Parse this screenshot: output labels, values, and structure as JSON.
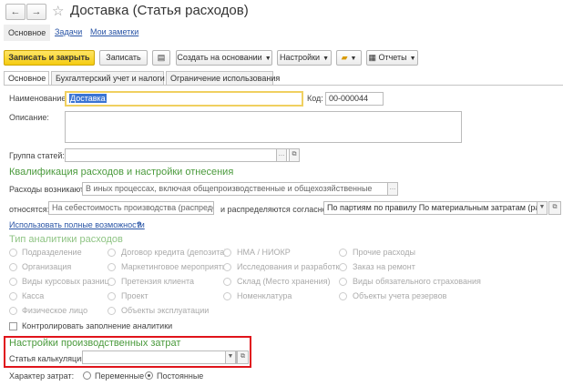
{
  "window": {
    "title": "Доставка (Статья расходов)"
  },
  "nav": {
    "back_glyph": "←",
    "forward_glyph": "→"
  },
  "top_tabs": {
    "main": "Основное",
    "tasks": "Задачи",
    "notes": "Мои заметки"
  },
  "toolbar": {
    "save_close": "Записать и закрыть",
    "save": "Записать",
    "create_based": "Создать на основании",
    "settings": "Настройки",
    "reports": "Отчеты"
  },
  "tabs": [
    "Основное",
    "Бухгалтерский учет и налоги",
    "Ограничение использования"
  ],
  "form": {
    "name_label": "Наименование:",
    "name_value": "Доставка",
    "code_label": "Код:",
    "code_value": "00-000044",
    "description_label": "Описание:",
    "group_label": "Группа статей:",
    "group_value": ""
  },
  "qualification": {
    "heading": "Квалификация расходов и настройки отнесения",
    "arise_label": "Расходы возникают:",
    "arise_value": "В иных процессах, включая общепроизводственные и общехозяйственные",
    "attribute_label": "относятся:",
    "attribute_value": "На себестоимость производства (распределяе",
    "distribute_label": "и распределяются согласно:",
    "distribute_value": "По партиям по правилу По материальным затратам (распре,",
    "use_full_link": "Использовать полные возможности",
    "help": "?"
  },
  "analytics": {
    "heading": "Тип аналитики расходов",
    "options": [
      "Подразделение",
      "Договор кредита (депозита)",
      "НМА / НИОКР",
      "Прочие расходы",
      "Организация",
      "Маркетинговое мероприятие",
      "Исследования и разработки",
      "Заказ на ремонт",
      "Виды курсовых разниц",
      "Претензия клиента",
      "Склад (Место хранения)",
      "Виды обязательного страхования",
      "Касса",
      "Проект",
      "Номенклатура",
      "Объекты учета резервов",
      "Физическое лицо",
      "Объекты эксплуатации"
    ],
    "control_label": "Контролировать заполнение аналитики"
  },
  "production": {
    "heading": "Настройки производственных затрат",
    "calc_label": "Статья калькуляции:",
    "calc_value": ""
  },
  "cost_nature": {
    "label": "Характер затрат:",
    "variable": "Переменные",
    "fixed": "Постоянные",
    "selected": "fixed"
  },
  "colors": {
    "accent_green": "#4a9a3c",
    "primary_yellow": "#f5cc12",
    "highlight_red": "#e0141b",
    "link_blue": "#2a55a6"
  }
}
